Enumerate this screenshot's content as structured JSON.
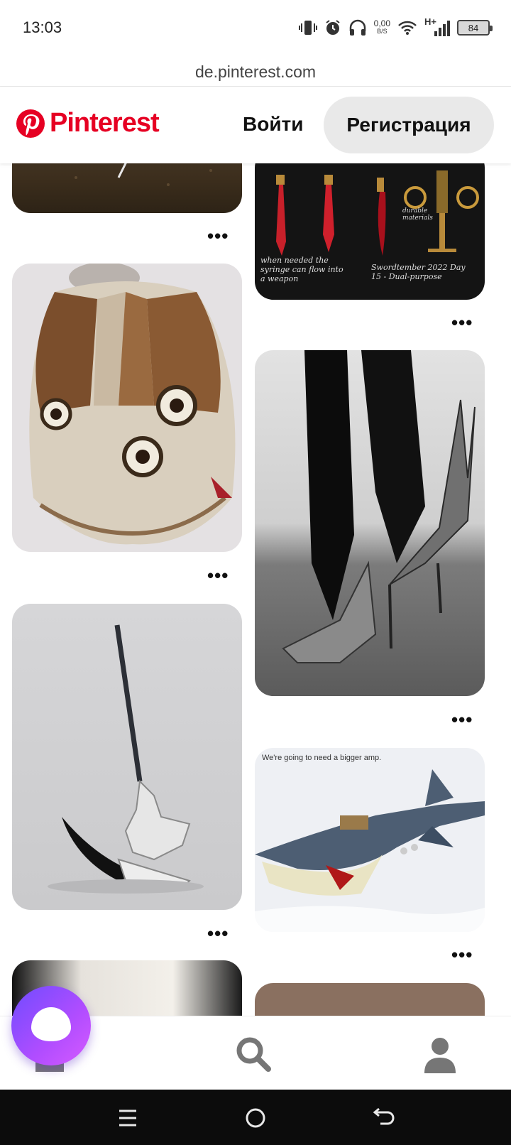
{
  "status_bar": {
    "time": "13:03",
    "net_speed_value": "0,00",
    "net_speed_unit": "B/S",
    "network_type": "H+",
    "battery": "84"
  },
  "browser": {
    "url": "de.pinterest.com"
  },
  "header": {
    "brand": "Pinterest",
    "login_label": "Войти",
    "signup_label": "Регистрация"
  },
  "pins": {
    "more_label": "•••",
    "syringe_caption_left": "when needed the syringe can flow into a weapon",
    "syringe_caption_right": "Swordtember 2022 Day 15 - Dual-purpose",
    "syringe_note": "durable materials",
    "shark_caption": "We're going to need a bigger amp."
  },
  "colors": {
    "brand": "#e60023",
    "signup_bg": "#e9e9e9",
    "nav_icon": "#767676"
  },
  "icons": {
    "home": "home-icon",
    "search": "search-icon",
    "profile": "profile-icon",
    "assistant": "assistant-icon"
  }
}
